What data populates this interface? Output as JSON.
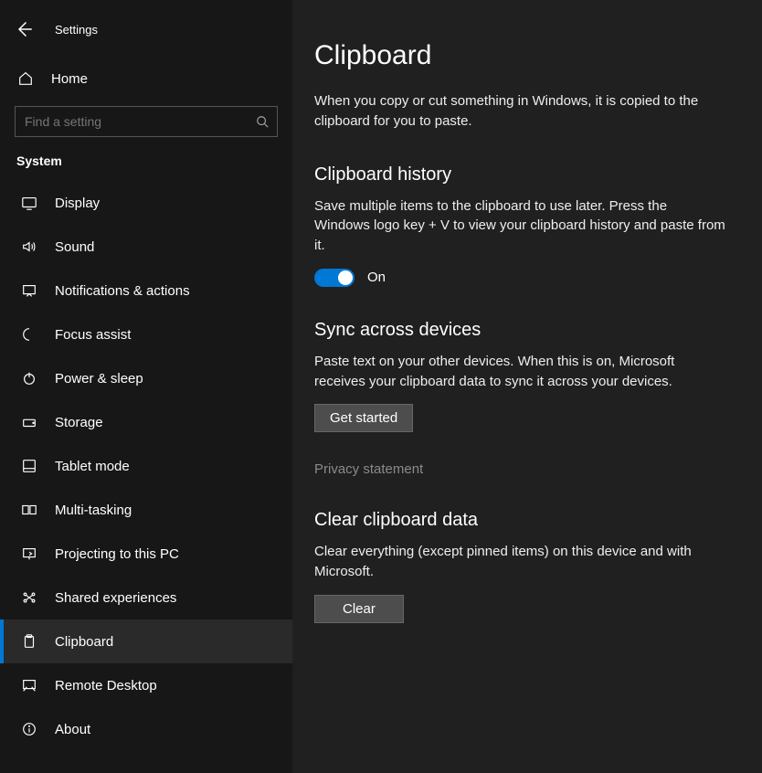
{
  "header": {
    "title": "Settings"
  },
  "home": {
    "label": "Home"
  },
  "search": {
    "placeholder": "Find a setting"
  },
  "section": {
    "label": "System"
  },
  "nav": [
    {
      "label": "Display"
    },
    {
      "label": "Sound"
    },
    {
      "label": "Notifications & actions"
    },
    {
      "label": "Focus assist"
    },
    {
      "label": "Power & sleep"
    },
    {
      "label": "Storage"
    },
    {
      "label": "Tablet mode"
    },
    {
      "label": "Multi-tasking"
    },
    {
      "label": "Projecting to this PC"
    },
    {
      "label": "Shared experiences"
    },
    {
      "label": "Clipboard"
    },
    {
      "label": "Remote Desktop"
    },
    {
      "label": "About"
    }
  ],
  "page": {
    "title": "Clipboard",
    "intro": "When you copy or cut something in Windows, it is copied to the clipboard for you to paste.",
    "history": {
      "heading": "Clipboard history",
      "desc": "Save multiple items to the clipboard to use later. Press the Windows logo key + V to view your clipboard history and paste from it.",
      "toggle_label": "On"
    },
    "sync": {
      "heading": "Sync across devices",
      "desc": "Paste text on your other devices. When this is on, Microsoft receives your clipboard data to sync it across your devices.",
      "button": "Get started",
      "privacy": "Privacy statement"
    },
    "clear": {
      "heading": "Clear clipboard data",
      "desc": "Clear everything (except pinned items) on this device and with Microsoft.",
      "button": "Clear"
    }
  }
}
